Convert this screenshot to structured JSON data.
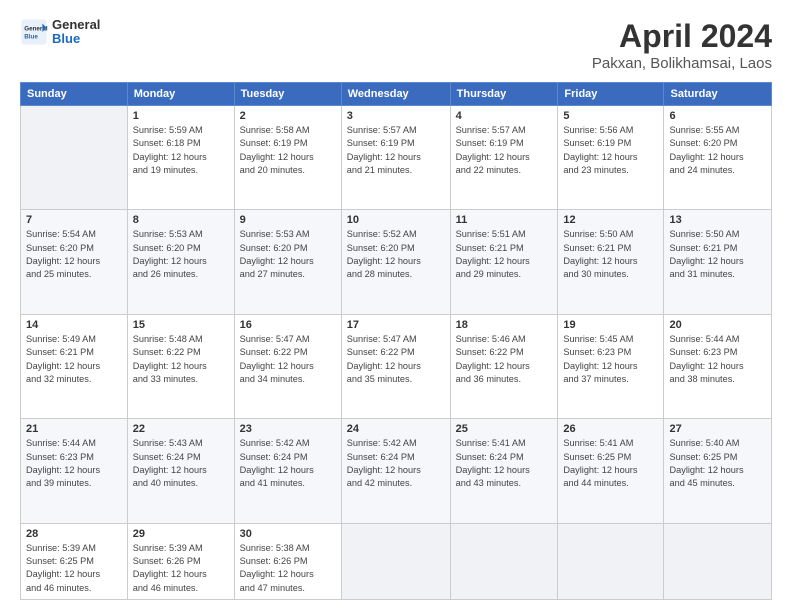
{
  "header": {
    "logo_general": "General",
    "logo_blue": "Blue",
    "title": "April 2024",
    "subtitle": "Pakxan, Bolikhamsai, Laos"
  },
  "days_of_week": [
    "Sunday",
    "Monday",
    "Tuesday",
    "Wednesday",
    "Thursday",
    "Friday",
    "Saturday"
  ],
  "weeks": [
    [
      {
        "day": "",
        "info": ""
      },
      {
        "day": "1",
        "info": "Sunrise: 5:59 AM\nSunset: 6:18 PM\nDaylight: 12 hours\nand 19 minutes."
      },
      {
        "day": "2",
        "info": "Sunrise: 5:58 AM\nSunset: 6:19 PM\nDaylight: 12 hours\nand 20 minutes."
      },
      {
        "day": "3",
        "info": "Sunrise: 5:57 AM\nSunset: 6:19 PM\nDaylight: 12 hours\nand 21 minutes."
      },
      {
        "day": "4",
        "info": "Sunrise: 5:57 AM\nSunset: 6:19 PM\nDaylight: 12 hours\nand 22 minutes."
      },
      {
        "day": "5",
        "info": "Sunrise: 5:56 AM\nSunset: 6:19 PM\nDaylight: 12 hours\nand 23 minutes."
      },
      {
        "day": "6",
        "info": "Sunrise: 5:55 AM\nSunset: 6:20 PM\nDaylight: 12 hours\nand 24 minutes."
      }
    ],
    [
      {
        "day": "7",
        "info": "Sunrise: 5:54 AM\nSunset: 6:20 PM\nDaylight: 12 hours\nand 25 minutes."
      },
      {
        "day": "8",
        "info": "Sunrise: 5:53 AM\nSunset: 6:20 PM\nDaylight: 12 hours\nand 26 minutes."
      },
      {
        "day": "9",
        "info": "Sunrise: 5:53 AM\nSunset: 6:20 PM\nDaylight: 12 hours\nand 27 minutes."
      },
      {
        "day": "10",
        "info": "Sunrise: 5:52 AM\nSunset: 6:20 PM\nDaylight: 12 hours\nand 28 minutes."
      },
      {
        "day": "11",
        "info": "Sunrise: 5:51 AM\nSunset: 6:21 PM\nDaylight: 12 hours\nand 29 minutes."
      },
      {
        "day": "12",
        "info": "Sunrise: 5:50 AM\nSunset: 6:21 PM\nDaylight: 12 hours\nand 30 minutes."
      },
      {
        "day": "13",
        "info": "Sunrise: 5:50 AM\nSunset: 6:21 PM\nDaylight: 12 hours\nand 31 minutes."
      }
    ],
    [
      {
        "day": "14",
        "info": "Sunrise: 5:49 AM\nSunset: 6:21 PM\nDaylight: 12 hours\nand 32 minutes."
      },
      {
        "day": "15",
        "info": "Sunrise: 5:48 AM\nSunset: 6:22 PM\nDaylight: 12 hours\nand 33 minutes."
      },
      {
        "day": "16",
        "info": "Sunrise: 5:47 AM\nSunset: 6:22 PM\nDaylight: 12 hours\nand 34 minutes."
      },
      {
        "day": "17",
        "info": "Sunrise: 5:47 AM\nSunset: 6:22 PM\nDaylight: 12 hours\nand 35 minutes."
      },
      {
        "day": "18",
        "info": "Sunrise: 5:46 AM\nSunset: 6:22 PM\nDaylight: 12 hours\nand 36 minutes."
      },
      {
        "day": "19",
        "info": "Sunrise: 5:45 AM\nSunset: 6:23 PM\nDaylight: 12 hours\nand 37 minutes."
      },
      {
        "day": "20",
        "info": "Sunrise: 5:44 AM\nSunset: 6:23 PM\nDaylight: 12 hours\nand 38 minutes."
      }
    ],
    [
      {
        "day": "21",
        "info": "Sunrise: 5:44 AM\nSunset: 6:23 PM\nDaylight: 12 hours\nand 39 minutes."
      },
      {
        "day": "22",
        "info": "Sunrise: 5:43 AM\nSunset: 6:24 PM\nDaylight: 12 hours\nand 40 minutes."
      },
      {
        "day": "23",
        "info": "Sunrise: 5:42 AM\nSunset: 6:24 PM\nDaylight: 12 hours\nand 41 minutes."
      },
      {
        "day": "24",
        "info": "Sunrise: 5:42 AM\nSunset: 6:24 PM\nDaylight: 12 hours\nand 42 minutes."
      },
      {
        "day": "25",
        "info": "Sunrise: 5:41 AM\nSunset: 6:24 PM\nDaylight: 12 hours\nand 43 minutes."
      },
      {
        "day": "26",
        "info": "Sunrise: 5:41 AM\nSunset: 6:25 PM\nDaylight: 12 hours\nand 44 minutes."
      },
      {
        "day": "27",
        "info": "Sunrise: 5:40 AM\nSunset: 6:25 PM\nDaylight: 12 hours\nand 45 minutes."
      }
    ],
    [
      {
        "day": "28",
        "info": "Sunrise: 5:39 AM\nSunset: 6:25 PM\nDaylight: 12 hours\nand 46 minutes."
      },
      {
        "day": "29",
        "info": "Sunrise: 5:39 AM\nSunset: 6:26 PM\nDaylight: 12 hours\nand 46 minutes."
      },
      {
        "day": "30",
        "info": "Sunrise: 5:38 AM\nSunset: 6:26 PM\nDaylight: 12 hours\nand 47 minutes."
      },
      {
        "day": "",
        "info": ""
      },
      {
        "day": "",
        "info": ""
      },
      {
        "day": "",
        "info": ""
      },
      {
        "day": "",
        "info": ""
      }
    ]
  ]
}
